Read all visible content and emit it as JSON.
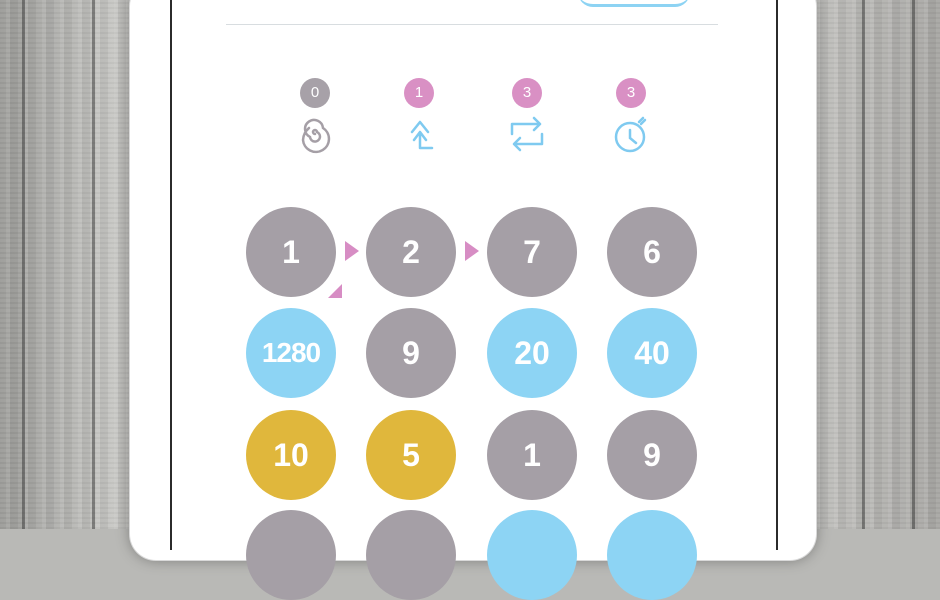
{
  "powerups": [
    {
      "count": "0",
      "icon": "spiral-icon",
      "badge_color": "#a7a1a8"
    },
    {
      "count": "1",
      "icon": "up-arrow-icon",
      "badge_color": "#d990c4"
    },
    {
      "count": "3",
      "icon": "swap-arrows-icon",
      "badge_color": "#d990c4"
    },
    {
      "count": "3",
      "icon": "stopwatch-icon",
      "badge_color": "#d990c4"
    }
  ],
  "grid": [
    [
      {
        "value": "1",
        "color": "grey"
      },
      {
        "value": "2",
        "color": "grey"
      },
      {
        "value": "7",
        "color": "grey"
      },
      {
        "value": "6",
        "color": "grey"
      }
    ],
    [
      {
        "value": "1280",
        "color": "blue"
      },
      {
        "value": "9",
        "color": "grey"
      },
      {
        "value": "20",
        "color": "blue"
      },
      {
        "value": "40",
        "color": "blue"
      }
    ],
    [
      {
        "value": "10",
        "color": "gold"
      },
      {
        "value": "5",
        "color": "gold"
      },
      {
        "value": "1",
        "color": "grey"
      },
      {
        "value": "9",
        "color": "grey"
      }
    ]
  ],
  "colors": {
    "grey": "#a59fa6",
    "blue": "#8dd4f4",
    "gold": "#e0b73c",
    "pink": "#d78dc4",
    "accent_blue": "#7fcaf0"
  }
}
